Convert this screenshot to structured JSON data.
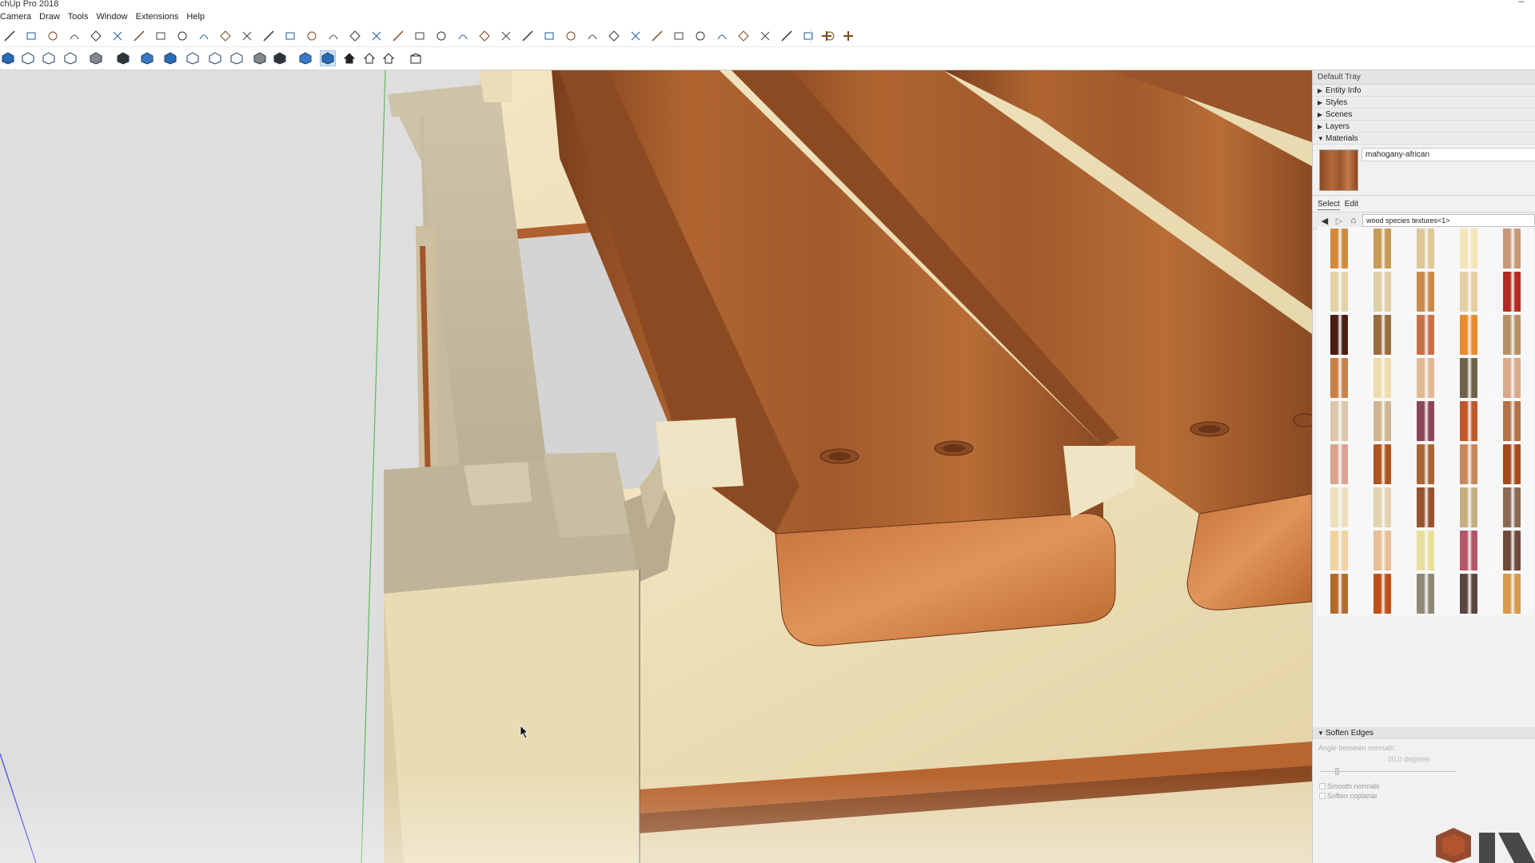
{
  "window": {
    "title": "chUp Pro 2018",
    "minimize_glyph": "–"
  },
  "menu": [
    "Camera",
    "Draw",
    "Tools",
    "Window",
    "Extensions",
    "Help"
  ],
  "toolbar1": {
    "icons": [
      "line-icon",
      "eraser-icon",
      "lasso-icon",
      "rectangle-icon",
      "rotated-rect-icon",
      "circle-icon",
      "polygon-icon",
      "arc-icon",
      "2pt-arc-icon",
      "3pt-arc-icon",
      "pie-icon",
      "freehand-icon",
      "bezier-icon",
      "offset-icon",
      "followme-icon",
      "pushpull-icon",
      "move-icon",
      "rotate-icon",
      "scale-icon",
      "flip-icon",
      "tape-icon",
      "protractor-icon",
      "axes-icon",
      "dimension-icon",
      "text-icon",
      "3dtext-icon",
      "section-icon",
      "sandbox-icon",
      "paint-icon",
      "orbit-icon",
      "pan-icon",
      "zoom-icon",
      "zoom-window-icon",
      "zoom-extents-icon",
      "previous-view-icon",
      "position-camera-icon",
      "walk-icon",
      "look-around-icon",
      "sun-icon"
    ],
    "right_icons": [
      "add-location-icon",
      "toggle-terrain-icon"
    ]
  },
  "toolbar2": {
    "icons": [
      "x-ray-icon",
      "back-edges-icon",
      "wireframe-icon",
      "hidden-line-icon",
      "shaded-icon",
      "monochrome-icon",
      "iso-view-icon",
      "top-view-icon",
      "front-view-icon",
      "right-view-icon",
      "back-view-icon",
      "left-view-icon",
      "bottom-view-icon",
      "shaded-textures-icon",
      "shaded-textures-active-icon",
      "house-icon",
      "house-outline-icon",
      "warehouse-icon",
      "open-box-icon"
    ]
  },
  "tray": {
    "title": "Default Tray",
    "panels": [
      {
        "label": "Entity Info",
        "expanded": false
      },
      {
        "label": "Styles",
        "expanded": false
      },
      {
        "label": "Scenes",
        "expanded": false
      },
      {
        "label": "Layers",
        "expanded": false
      },
      {
        "label": "Materials",
        "expanded": true
      }
    ],
    "materials": {
      "current_name": "mahogany-african",
      "tabs": [
        "Select",
        "Edit"
      ],
      "active_tab": "Select",
      "library": "wood species textures<1>",
      "swatch_colors": [
        "#d38b3a",
        "#c79a55",
        "#ddc796",
        "#f3e6b6",
        "#c79776",
        "#e4d2a4",
        "#dfcea6",
        "#c98a4a",
        "#e3cfa2",
        "#b42a1e",
        "#4a1c12",
        "#9a6d3e",
        "#c8704a",
        "#e88a2e",
        "#b89066",
        "#c98046",
        "#eedcaa",
        "#e0b994",
        "#6e6248",
        "#d9a98a",
        "#dcc7ac",
        "#cfb591",
        "#8a4656",
        "#c0582a",
        "#b47244",
        "#d9a38e",
        "#b0541e",
        "#a86434",
        "#c8875a",
        "#a64a1c",
        "#ece0bc",
        "#e2d2b0",
        "#98522e",
        "#c7ae80",
        "#8a6a52",
        "#f1d3a0",
        "#e9be94",
        "#e7df9a",
        "#b45666",
        "#6e4a3c",
        "#b26a2a",
        "#c0501a",
        "#8e8874",
        "#5a4640",
        "#d89a4e"
      ]
    },
    "soften": {
      "label": "Soften Edges",
      "angle_label": "Angle between normals:",
      "angle_value": "20.0  degrees",
      "options": [
        "Smooth normals",
        "Soften coplanar"
      ]
    }
  },
  "colors": {
    "mahogany": "#a45a2c",
    "maple_light": "#efe2bd",
    "maple_edge": "#d9c79c",
    "oak_grey": "#bdb198",
    "background": "#dcdcdc",
    "axis_green": "#5bb85b",
    "axis_blue": "#3a3af0"
  }
}
